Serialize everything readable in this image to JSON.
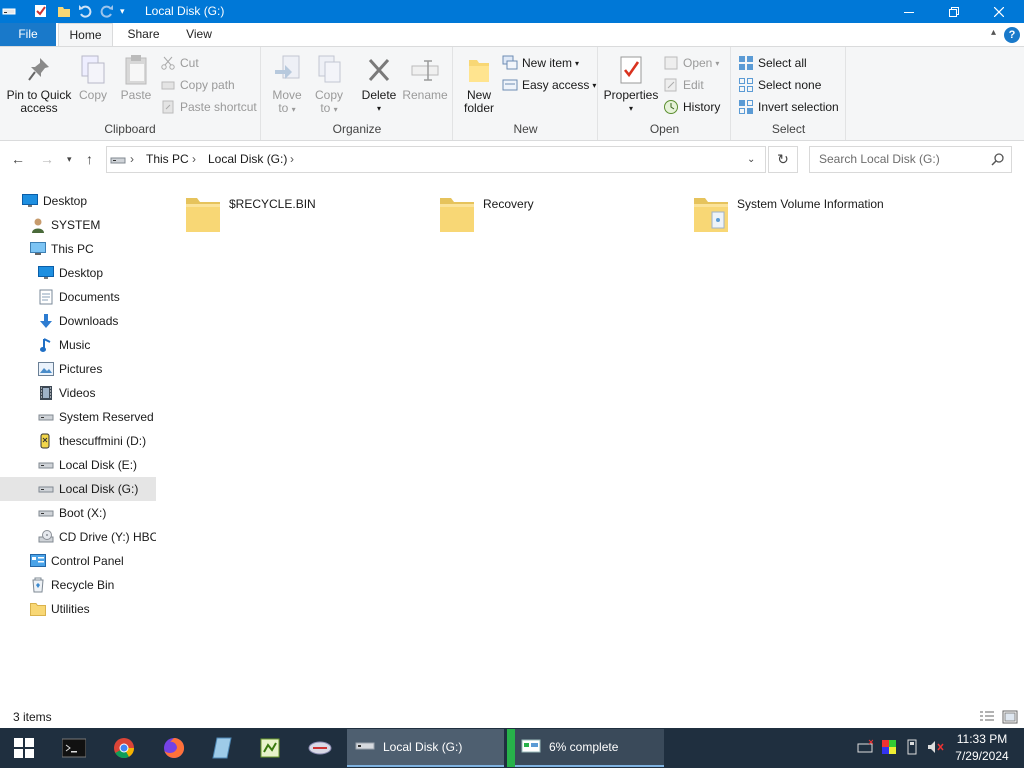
{
  "window": {
    "title": "Local Disk (G:)"
  },
  "ribbon_tabs": [
    "File",
    "Home",
    "Share",
    "View"
  ],
  "ribbon": {
    "clipboard": {
      "label": "Clipboard",
      "pin": "Pin to Quick access",
      "pin_line1": "Pin to Quick",
      "pin_line2": "access",
      "copy": "Copy",
      "paste": "Paste",
      "cut": "Cut",
      "copy_path": "Copy path",
      "paste_shortcut": "Paste shortcut"
    },
    "organize": {
      "label": "Organize",
      "move_to_1": "Move",
      "move_to_2": "to",
      "copy_to_1": "Copy",
      "copy_to_2": "to",
      "delete": "Delete",
      "rename": "Rename"
    },
    "new": {
      "label": "New",
      "new_folder_1": "New",
      "new_folder_2": "folder",
      "new_item": "New item",
      "easy_access": "Easy access"
    },
    "open": {
      "label": "Open",
      "properties": "Properties",
      "open": "Open",
      "edit": "Edit",
      "history": "History"
    },
    "select": {
      "label": "Select",
      "select_all": "Select all",
      "select_none": "Select none",
      "invert": "Invert selection"
    }
  },
  "address": {
    "crumbs": [
      "This PC",
      "Local Disk (G:)"
    ]
  },
  "search": {
    "placeholder": "Search Local Disk (G:)"
  },
  "nav": [
    {
      "label": "Desktop",
      "icon": "desktop-icon",
      "indent": 0
    },
    {
      "label": "SYSTEM",
      "icon": "user-icon",
      "indent": 1
    },
    {
      "label": "This PC",
      "icon": "computer-icon",
      "indent": 1
    },
    {
      "label": "Desktop",
      "icon": "desktop-icon",
      "indent": 2
    },
    {
      "label": "Documents",
      "icon": "documents-icon",
      "indent": 2
    },
    {
      "label": "Downloads",
      "icon": "downloads-icon",
      "indent": 2
    },
    {
      "label": "Music",
      "icon": "music-icon",
      "indent": 2
    },
    {
      "label": "Pictures",
      "icon": "pictures-icon",
      "indent": 2
    },
    {
      "label": "Videos",
      "icon": "videos-icon",
      "indent": 2
    },
    {
      "label": "System Reserved (",
      "icon": "drive-icon",
      "indent": 2
    },
    {
      "label": "thescuffmini (D:)",
      "icon": "usb-drive-icon",
      "indent": 2
    },
    {
      "label": "Local Disk (E:)",
      "icon": "drive-icon",
      "indent": 2
    },
    {
      "label": "Local Disk (G:)",
      "icon": "drive-icon",
      "indent": 2,
      "selected": true
    },
    {
      "label": "Boot (X:)",
      "icon": "drive-icon",
      "indent": 2
    },
    {
      "label": "CD Drive (Y:) HBC",
      "icon": "cd-drive-icon",
      "indent": 2
    },
    {
      "label": "Control Panel",
      "icon": "control-panel-icon",
      "indent": 1
    },
    {
      "label": "Recycle Bin",
      "icon": "recycle-bin-icon",
      "indent": 1
    },
    {
      "label": "Utilities",
      "icon": "folder-icon",
      "indent": 1
    }
  ],
  "files": [
    {
      "name": "$RECYCLE.BIN",
      "icon": "folder-icon"
    },
    {
      "name": "Recovery",
      "icon": "folder-icon"
    },
    {
      "name": "System Volume Information",
      "icon": "folder-icon"
    }
  ],
  "status": {
    "items": "3 items"
  },
  "taskbar": {
    "windows": [
      {
        "label": "Local Disk (G:)"
      },
      {
        "label": "6% complete"
      }
    ],
    "time": "11:33 PM",
    "date": "7/29/2024"
  },
  "colors": {
    "accent": "#0078d7",
    "taskbar": "#1f2f3f",
    "folder": "#f8d775"
  }
}
